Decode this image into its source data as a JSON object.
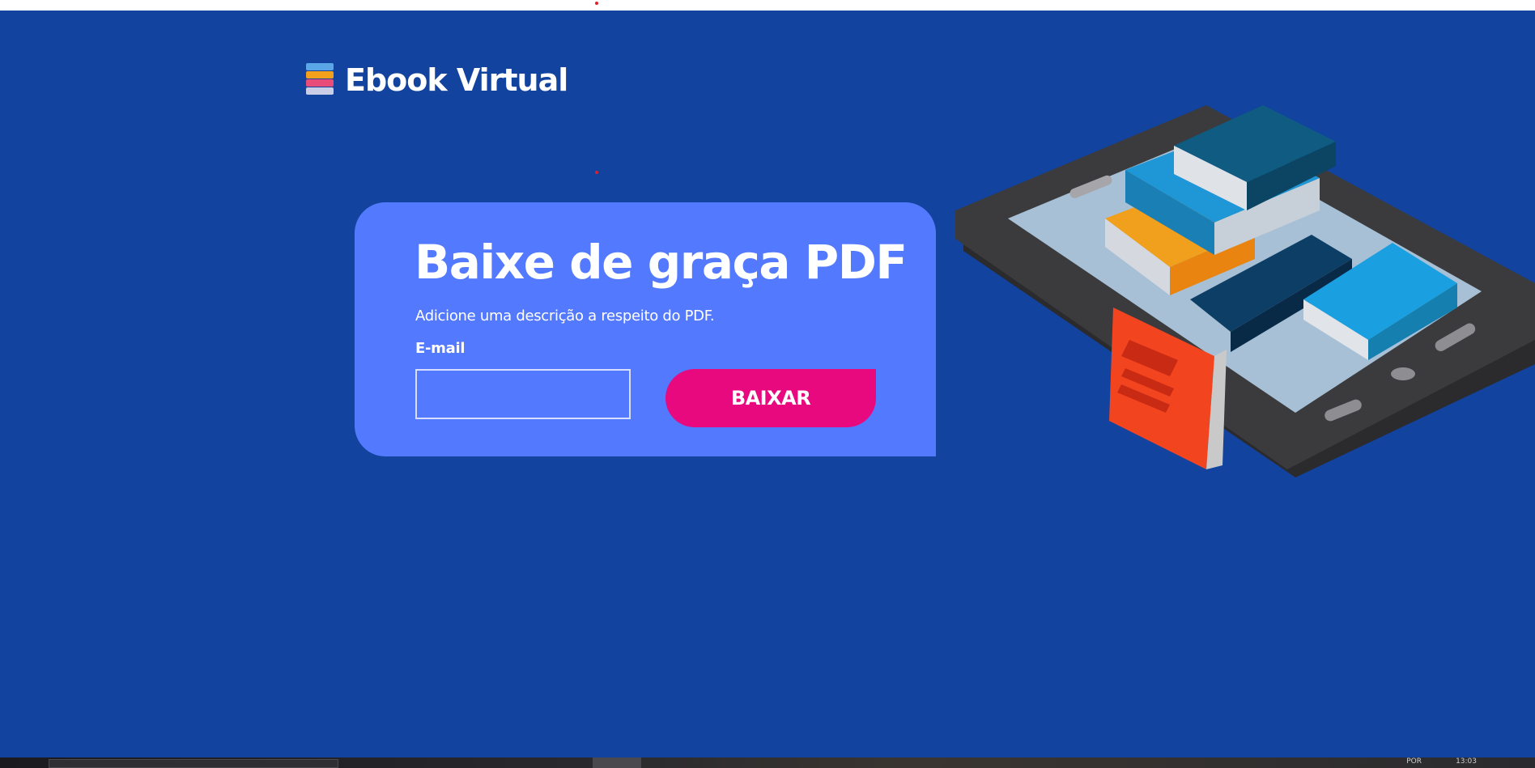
{
  "brand": {
    "name": "Ebook Virtual"
  },
  "hero": {
    "title": "Baixe de graça PDF",
    "description": "Adicione uma descrição a respeito do PDF.",
    "email_label": "E-mail",
    "email_value": "",
    "button_label": "BAIXAR"
  },
  "taskbar": {
    "tray_text": "POR",
    "clock_text": "13:03"
  },
  "colors": {
    "background": "#11439f",
    "card": "#5379fe",
    "button": "#e8097e",
    "text": "#ffffff"
  },
  "icons": {
    "logo": "books-stack-icon",
    "illustration": "tablet-with-books-illustration"
  }
}
